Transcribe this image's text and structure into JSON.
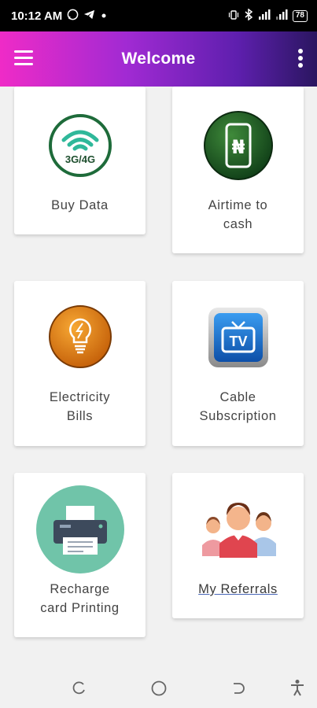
{
  "status_bar": {
    "time": "10:12 AM",
    "battery": "78"
  },
  "app_bar": {
    "title": "Welcome"
  },
  "tiles": {
    "buy_data": {
      "label": "Buy Data",
      "icon_text": "3G/4G"
    },
    "airtime": {
      "label": "Airtime to\ncash",
      "icon_text": "₦"
    },
    "electricity": {
      "label": "Electricity\nBills"
    },
    "cable": {
      "label": "Cable\nSubscription",
      "icon_text": "TV"
    },
    "recharge": {
      "label": "Recharge\ncard Printing"
    },
    "referrals": {
      "label": "My Referrals"
    }
  },
  "colors": {
    "accent_pink": "#ef2bc7",
    "accent_purple": "#5e1fae",
    "background": "#f1f1f1"
  },
  "icons": [
    "menu-icon",
    "more-vert-icon",
    "wifi-3g4g-icon",
    "phone-naira-icon",
    "lightbulb-icon",
    "tv-icon",
    "printer-icon",
    "people-icon"
  ]
}
